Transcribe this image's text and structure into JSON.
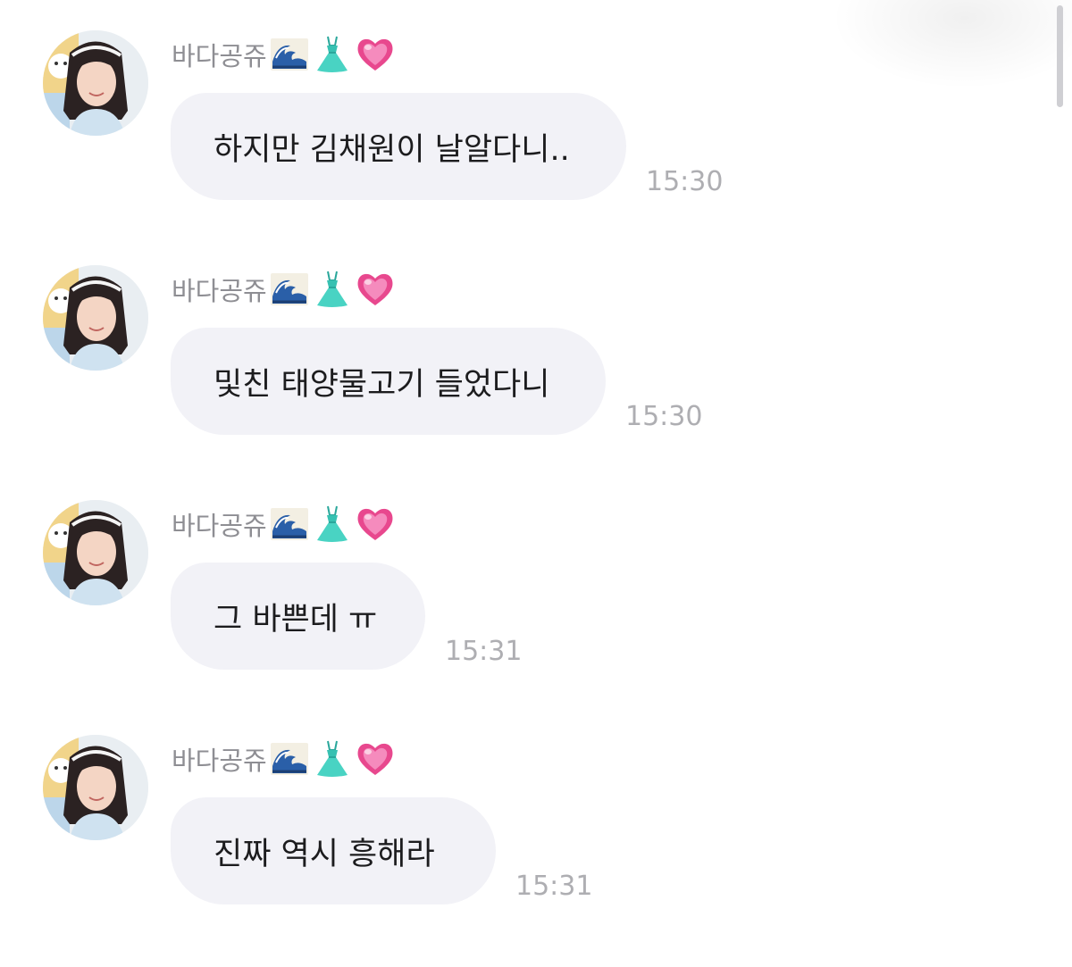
{
  "chat": {
    "messages": [
      {
        "sender": "바다공쥬",
        "text": "하지만 김채원이 날알다니..",
        "time": "15:30"
      },
      {
        "sender": "바다공쥬",
        "text": "및친 태양물고기 들었다니",
        "time": "15:30"
      },
      {
        "sender": "바다공쥬",
        "text": "그 바쁜데 ㅠ",
        "time": "15:31"
      },
      {
        "sender": "바다공쥬",
        "text": "진짜 역시 흥해라",
        "time": "15:31"
      }
    ],
    "sender_emojis": [
      "wave-emoji",
      "dress-emoji",
      "heart-emoji"
    ]
  },
  "colors": {
    "bubble_bg": "#f2f2f7",
    "sender_name": "#8e8e93",
    "timestamp": "#aeaeb2",
    "message_text": "#1c1c1e"
  }
}
